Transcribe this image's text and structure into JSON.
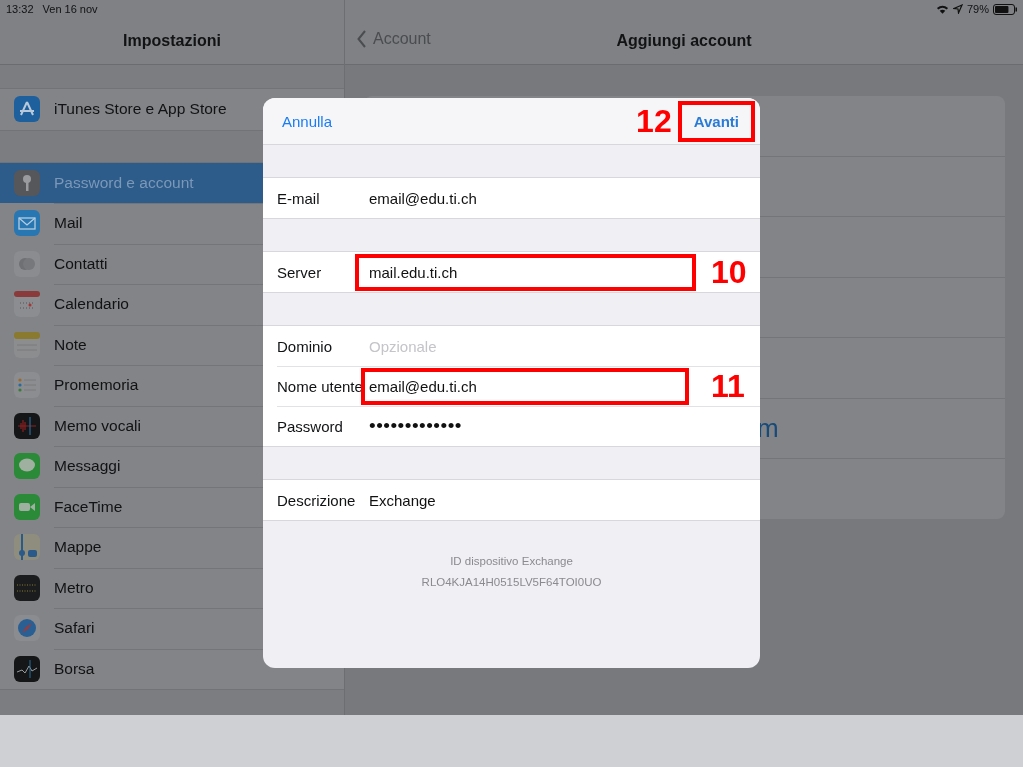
{
  "status_bar": {
    "time": "13:32",
    "date": "Ven 16 nov",
    "battery": "79%"
  },
  "sidebar": {
    "title": "Impostazioni",
    "top_items": [
      {
        "label": "iTunes Store e App Store",
        "kind": "appstore",
        "selected": false
      }
    ],
    "items": [
      {
        "label": "Password e account",
        "kind": "key",
        "selected": true
      },
      {
        "label": "Mail",
        "kind": "mail",
        "selected": false
      },
      {
        "label": "Contatti",
        "kind": "contacts",
        "selected": false
      },
      {
        "label": "Calendario",
        "kind": "calendar",
        "selected": false
      },
      {
        "label": "Note",
        "kind": "notes",
        "selected": false
      },
      {
        "label": "Promemoria",
        "kind": "reminders",
        "selected": false
      },
      {
        "label": "Memo vocali",
        "kind": "voice",
        "selected": false
      },
      {
        "label": "Messaggi",
        "kind": "messages",
        "selected": false
      },
      {
        "label": "FaceTime",
        "kind": "facetime",
        "selected": false
      },
      {
        "label": "Mappe",
        "kind": "maps",
        "selected": false
      },
      {
        "label": "Metro",
        "kind": "measure",
        "selected": false
      },
      {
        "label": "Safari",
        "kind": "safari",
        "selected": false
      },
      {
        "label": "Borsa",
        "kind": "stocks",
        "selected": false
      }
    ]
  },
  "detail": {
    "back": "Account",
    "title": "Aggiungi account",
    "background_text": "m"
  },
  "dialog": {
    "cancel": "Annulla",
    "confirm": "Avanti",
    "confirm_annotation": "12",
    "sections": [
      [
        {
          "label": "E-mail",
          "value": "email@edu.ti.ch"
        }
      ],
      [
        {
          "label": "Server",
          "value": "mail.edu.ti.ch",
          "annotation": "10"
        }
      ],
      [
        {
          "label": "Dominio",
          "placeholder": "Opzionale"
        },
        {
          "label": "Nome utente",
          "value": "email@edu.ti.ch",
          "annotation": "11"
        },
        {
          "label": "Password",
          "kind": "password",
          "value": "•••••••••••••"
        }
      ],
      [
        {
          "label": "Descrizione",
          "value": "Exchange"
        }
      ]
    ],
    "footer": [
      "ID dispositivo Exchange",
      "RLO4KJA14H0515LV5F64TOI0UO"
    ]
  }
}
